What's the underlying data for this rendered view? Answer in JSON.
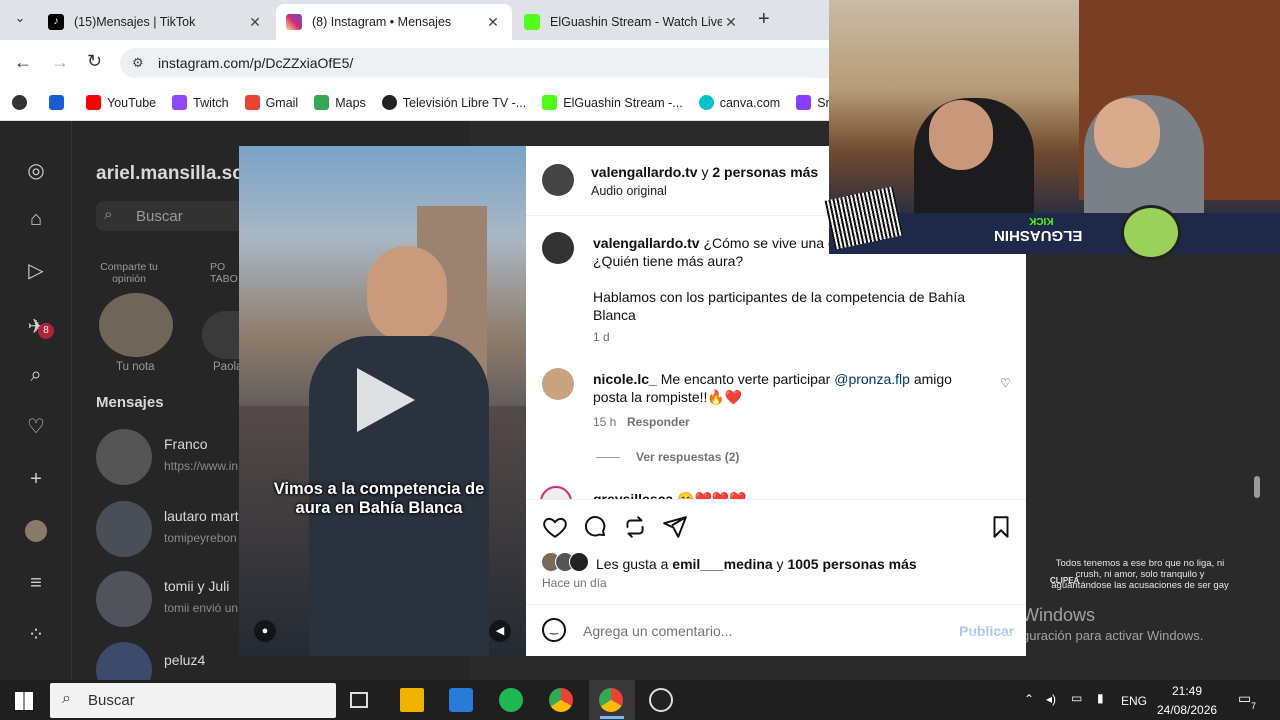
{
  "browser": {
    "tabs": [
      {
        "title": "(15)Mensajes | TikTok",
        "color": "#000000"
      },
      {
        "title": "(8) Instagram • Mensajes",
        "color": "#d62976"
      },
      {
        "title": "ElGuashin Stream - Watch Live",
        "color": "#53fc18"
      }
    ],
    "new_tab": "+",
    "url": "instagram.com/p/DcZZxiaOfE5/",
    "bookmarks": [
      {
        "label": "YouTube",
        "color": "#ff0000"
      },
      {
        "label": "Twitch",
        "color": "#9146ff"
      },
      {
        "label": "Gmail",
        "color": "#ea4335"
      },
      {
        "label": "Maps",
        "color": "#34a853"
      },
      {
        "label": "Televisión Libre TV -...",
        "color": "#222222"
      },
      {
        "label": "ElGuashin Stream -...",
        "color": "#53fc18"
      },
      {
        "label": "canva.com",
        "color": "#00c4cc"
      },
      {
        "label": "SnapIns",
        "color": "#8b3dff"
      }
    ]
  },
  "instagram": {
    "sidebar_badge": "8",
    "username": "ariel.mansilla.sc",
    "search_placeholder": "Buscar",
    "note_share": "Comparte tu opinión",
    "notes": [
      {
        "label": "Tu nota"
      },
      {
        "label": "Paola"
      }
    ],
    "note_partial": "PO TABO",
    "messages_title": "Mensajes",
    "conversations": [
      {
        "name": "Franco",
        "preview": "https://www.in"
      },
      {
        "name": "lautaro mart",
        "preview": "tomipeyrebon"
      },
      {
        "name": "tomii y Juli",
        "preview": "tomii envió un"
      },
      {
        "name": "peluz4",
        "preview": ""
      }
    ]
  },
  "post": {
    "author": "valengallardo.tv",
    "collab_suffix": " y ",
    "collab_more": "2 personas más",
    "audio": "Audio original",
    "caption_user": "valengallardo.tv",
    "caption_text": " ¿Cómo se vive una competencia de aura? ¿Quién tiene más aura?",
    "caption_line2": "Hablamos con los participantes de la competencia de Bahía Blanca",
    "caption_time": "1 d",
    "comment_user": "nicole.lc_",
    "comment_text_1": " Me encanto verte participar ",
    "comment_mention": "@pronza.flp",
    "comment_text_2": " amigo posta la rompiste!!🔥❤️",
    "comment_time": "15 h",
    "reply_label": "Responder",
    "view_replies": "Ver respuestas (2)",
    "next_comment_user": "greysillesca",
    "next_comment_text": " 😊❤️❤️❤️",
    "likes_prefix": "Les gusta a ",
    "likes_user": "emil___medina",
    "likes_mid": " y ",
    "likes_count": "1005 personas más",
    "posted": "Hace un día",
    "comment_placeholder": "Agrega un comentario...",
    "publish": "Publicar",
    "video_caption": "Vimos a la competencia de aura en Bahía Blanca"
  },
  "stream": {
    "kick_label": "KICK",
    "channel": "ELGUASHIN",
    "chat_text": "Todos tenemos a ese bro que no liga, ni crush, ni amor, solo tranquilo y aguantándose las acusaciones de ser gay",
    "chat_tag": "CLIPEA"
  },
  "windows_watermark": {
    "title": "Activar Windows",
    "subtitle": "Ve a Configuración para activar Windows."
  },
  "taskbar": {
    "search_placeholder": "Buscar",
    "language": "ENG",
    "time": "21:49",
    "date": "24/08/2026",
    "notifications": "7"
  }
}
